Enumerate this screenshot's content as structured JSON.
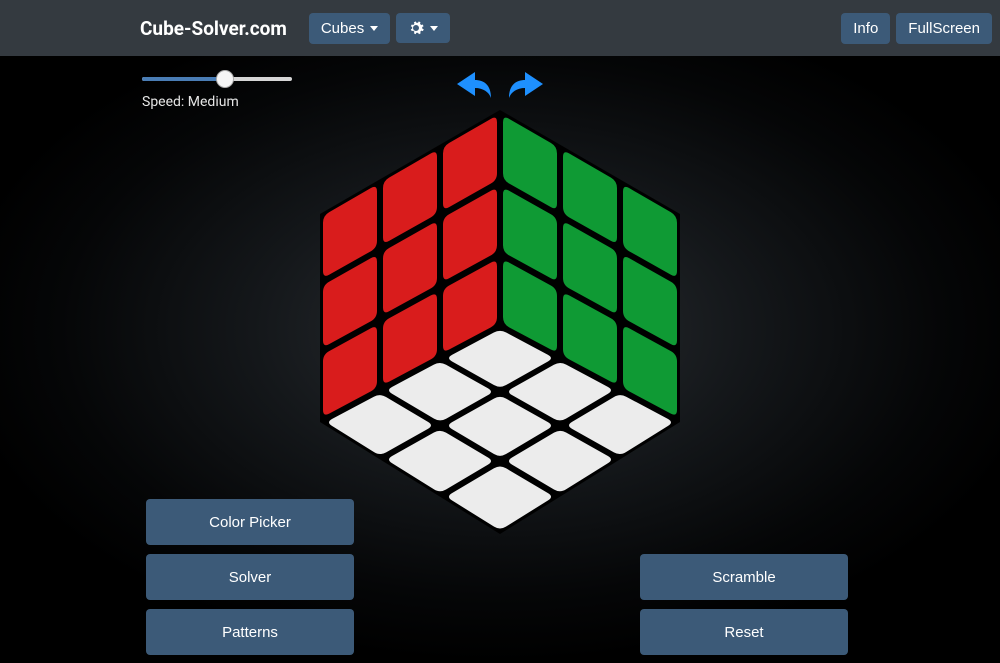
{
  "nav": {
    "brand": "Cube-Solver.com",
    "cubes_label": "Cubes",
    "info_label": "Info",
    "fullscreen_label": "FullScreen"
  },
  "speed": {
    "label": "Speed: Medium",
    "value_percent": 55
  },
  "buttons": {
    "color_picker": "Color Picker",
    "solver": "Solver",
    "patterns": "Patterns",
    "scramble": "Scramble",
    "reset": "Reset"
  },
  "arrow_color": "#1e90ff",
  "cube": {
    "colors": {
      "left": "#d91c1c",
      "right": "#0f9a34",
      "bottom": "#ececec",
      "edge": "#000000"
    }
  }
}
